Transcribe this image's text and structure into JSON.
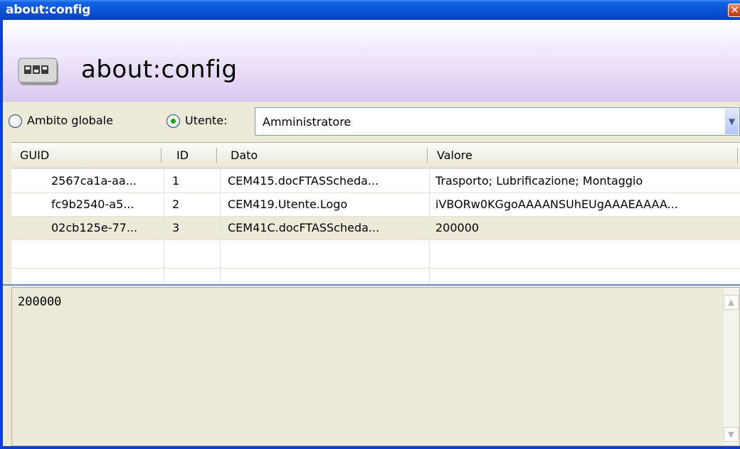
{
  "window": {
    "title": "about:config",
    "close_glyph": "✕"
  },
  "header": {
    "title": "about:config",
    "icon": "config-panel-icon"
  },
  "scope": {
    "global_label": "Ambito globale",
    "user_label": "Utente:",
    "selected": "user",
    "user_value": "Amministratore"
  },
  "grid": {
    "columns": [
      "GUID",
      "ID",
      "Dato",
      "Valore"
    ],
    "rows": [
      {
        "guid": "2567ca1a-aa...",
        "id": "1",
        "dato": "CEM415.docFTASScheda...",
        "valore": "Trasporto; Lubrificazione; Montaggio"
      },
      {
        "guid": "fc9b2540-a5...",
        "id": "2",
        "dato": "CEM419.Utente.Logo",
        "valore": "iVBORw0KGgoAAAANSUhEUgAAAEAAAA..."
      },
      {
        "guid": "02cb125e-77...",
        "id": "3",
        "dato": "CEM41C.docFTASScheda...",
        "valore": "200000"
      }
    ],
    "selected_row": 2
  },
  "detail": {
    "text": "200000"
  },
  "colors": {
    "titlebar": "#0a55d8",
    "selection": "#ece9d8",
    "radio_dot": "#21a121"
  }
}
